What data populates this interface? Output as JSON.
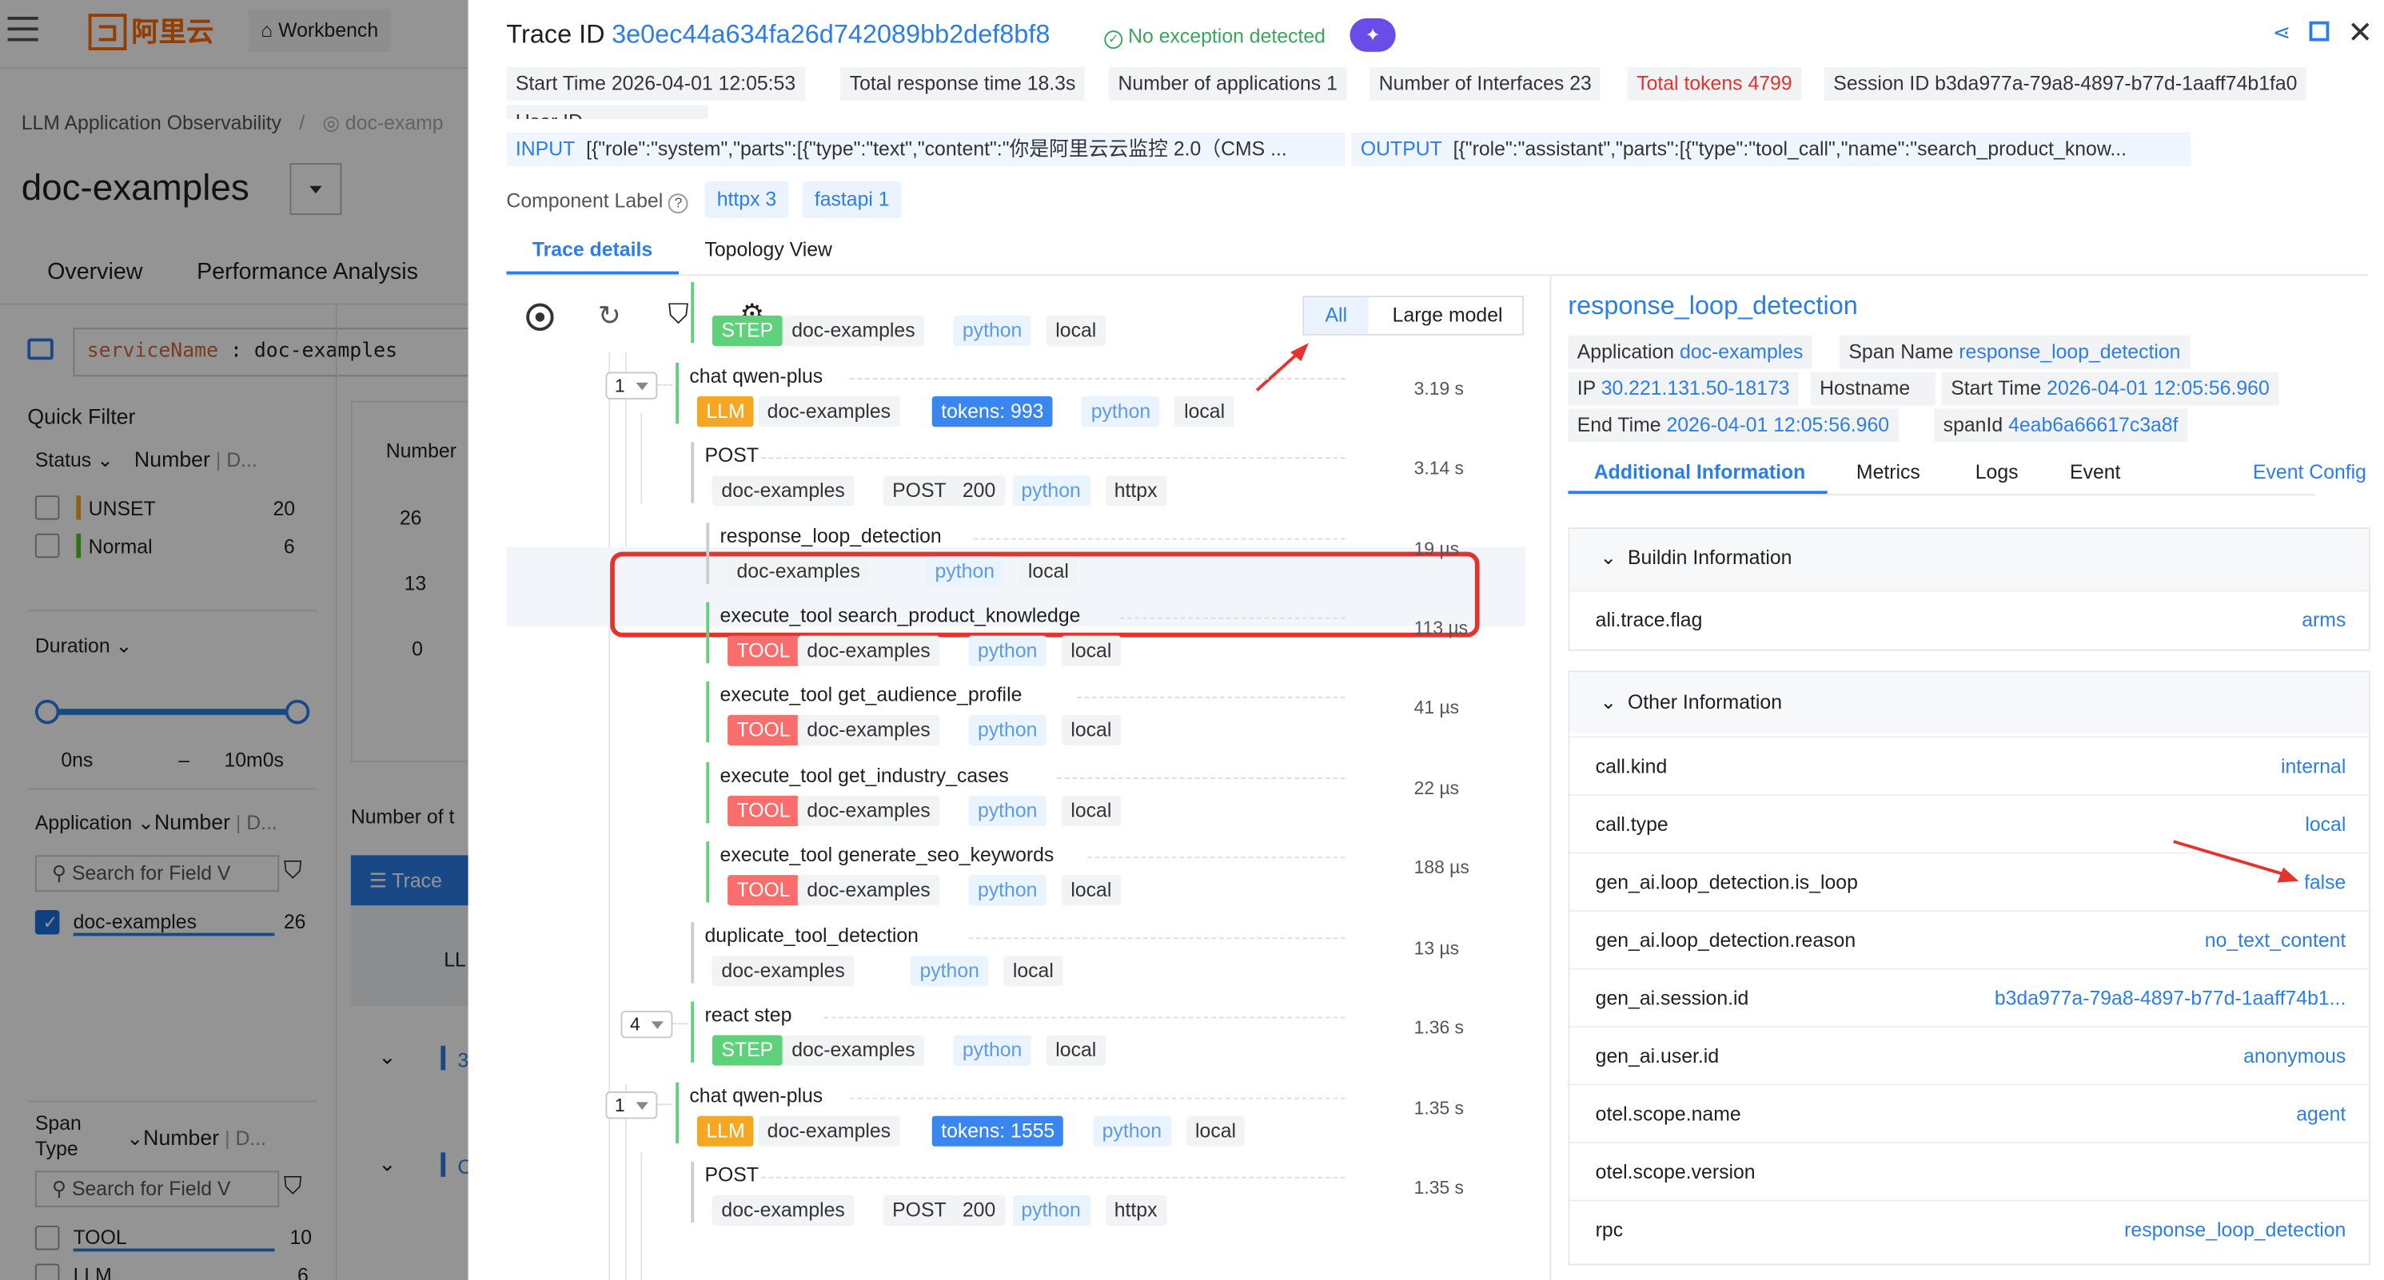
{
  "bg": {
    "logo": "阿里云",
    "workbench": "Workbench",
    "breadcrumb": "LLM Application Observability",
    "breadcrumb_sep": "/",
    "breadcrumb_next": "doc-examp",
    "app_name": "doc-examples",
    "tabs": [
      "Overview",
      "Performance Analysis"
    ],
    "query_key": "serviceName",
    "query_sep": ":",
    "query_val": "doc-examples",
    "quick_filter": "Quick Filter",
    "status_label": "Status",
    "number_label": "Number",
    "d_label": "D...",
    "status_items": [
      {
        "label": "UNSET",
        "count": "20",
        "color": "#f5a623"
      },
      {
        "label": "Normal",
        "count": "6",
        "color": "#52c41a"
      }
    ],
    "duration_label": "Duration",
    "dur_min": "0ns",
    "dur_dash": "–",
    "dur_max": "10m0s",
    "application_label": "Application",
    "search_field": "Search for Field V",
    "app_items": [
      {
        "label": "doc-examples",
        "count": "26"
      }
    ],
    "span_type_label": "Span Type",
    "span_items": [
      {
        "label": "TOOL",
        "count": "10"
      },
      {
        "label": "LLM",
        "count": "6"
      }
    ],
    "chart_head": "Number",
    "chart_ticks": [
      "26",
      "13",
      "0"
    ],
    "number_of": "Number of t",
    "trace_btn": "Trace",
    "ll": "LL",
    "side_num1": "3",
    "side_num2": "C"
  },
  "header": {
    "trace_label": "Trace ID",
    "trace_id": "3e0ec44a634fa26d742089bb2def8bf8",
    "status": "No exception detected",
    "start_label": "Start Time",
    "start": "2026-04-01 12:05:53",
    "resp_label": "Total response time",
    "resp": "18.3s",
    "apps_label": "Number of applications",
    "apps": "1",
    "ifaces_label": "Number of Interfaces",
    "ifaces": "23",
    "tokens_label": "Total tokens",
    "tokens": "4799",
    "session_label": "Session ID",
    "session": "b3da977a-79a8-4897-b77d-1aaff74b1fa0",
    "user_label": "User ID",
    "input_label": "INPUT",
    "input": "[{\"role\":\"system\",\"parts\":[{\"type\":\"text\",\"content\":\"你是阿里云云监控 2.0（CMS ...",
    "output_label": "OUTPUT",
    "output": "[{\"role\":\"assistant\",\"parts\":[{\"type\":\"tool_call\",\"name\":\"search_product_know...",
    "component_label": "Component Label",
    "comp_tags": [
      "httpx 3",
      "fastapi 1"
    ],
    "tabs": [
      "Trace details",
      "Topology View"
    ]
  },
  "toolbar": {
    "seg_all": "All",
    "seg_large": "Large model"
  },
  "spans": [
    {
      "name": "",
      "type": "STEP",
      "tags": [
        "doc-examples",
        "python",
        "local"
      ],
      "dur": ""
    },
    {
      "name": "chat qwen-plus",
      "type": "LLM",
      "tokens": "tokens: 993",
      "tags": [
        "doc-examples",
        "python",
        "local"
      ],
      "dur": "3.19 s",
      "count": "1"
    },
    {
      "name": "POST",
      "type": "",
      "tags": [
        "doc-examples",
        "POST",
        "200",
        "python",
        "httpx"
      ],
      "dur": "3.14 s"
    },
    {
      "name": "response_loop_detection",
      "type": "",
      "tags": [
        "doc-examples",
        "python",
        "local"
      ],
      "dur": "19 µs"
    },
    {
      "name": "execute_tool search_product_knowledge",
      "type": "TOOL",
      "tags": [
        "doc-examples",
        "python",
        "local"
      ],
      "dur": "113 µs"
    },
    {
      "name": "execute_tool get_audience_profile",
      "type": "TOOL",
      "tags": [
        "doc-examples",
        "python",
        "local"
      ],
      "dur": "41 µs"
    },
    {
      "name": "execute_tool get_industry_cases",
      "type": "TOOL",
      "tags": [
        "doc-examples",
        "python",
        "local"
      ],
      "dur": "22 µs"
    },
    {
      "name": "execute_tool generate_seo_keywords",
      "type": "TOOL",
      "tags": [
        "doc-examples",
        "python",
        "local"
      ],
      "dur": "188 µs"
    },
    {
      "name": "duplicate_tool_detection",
      "type": "",
      "tags": [
        "doc-examples",
        "python",
        "local"
      ],
      "dur": "13 µs"
    },
    {
      "name": "react step",
      "type": "STEP",
      "tags": [
        "doc-examples",
        "python",
        "local"
      ],
      "dur": "1.36 s",
      "count": "4"
    },
    {
      "name": "chat qwen-plus",
      "type": "LLM",
      "tokens": "tokens: 1555",
      "tags": [
        "doc-examples",
        "python",
        "local"
      ],
      "dur": "1.35 s",
      "count": "1"
    },
    {
      "name": "POST",
      "type": "",
      "tags": [
        "doc-examples",
        "POST",
        "200",
        "python",
        "httpx"
      ],
      "dur": "1.35 s"
    }
  ],
  "detail": {
    "title": "response_loop_detection",
    "app_label": "Application",
    "app": "doc-examples",
    "span_label": "Span Name",
    "span": "response_loop_detection",
    "ip_label": "IP",
    "ip": "30.221.131.50-18173",
    "host_label": "Hostname",
    "start_label": "Start Time",
    "start": "2026-04-01 12:05:56.960",
    "end_label": "End Time",
    "end": "2026-04-01 12:05:56.960",
    "spanid_label": "spanId",
    "spanid": "4eab6a66617c3a8f",
    "tabs": [
      "Additional Information",
      "Metrics",
      "Logs",
      "Event"
    ],
    "event_config": "Event Config",
    "buildin_title": "Buildin Information",
    "buildin": [
      {
        "k": "ali.trace.flag",
        "v": "arms"
      }
    ],
    "other_title": "Other Information",
    "other": [
      {
        "k": "call.kind",
        "v": "internal"
      },
      {
        "k": "call.type",
        "v": "local"
      },
      {
        "k": "gen_ai.loop_detection.is_loop",
        "v": "false"
      },
      {
        "k": "gen_ai.loop_detection.reason",
        "v": "no_text_content"
      },
      {
        "k": "gen_ai.session.id",
        "v": "b3da977a-79a8-4897-b77d-1aaff74b1..."
      },
      {
        "k": "gen_ai.user.id",
        "v": "anonymous"
      },
      {
        "k": "otel.scope.name",
        "v": "agent"
      },
      {
        "k": "otel.scope.version",
        "v": ""
      },
      {
        "k": "rpc",
        "v": "response_loop_detection"
      }
    ]
  }
}
